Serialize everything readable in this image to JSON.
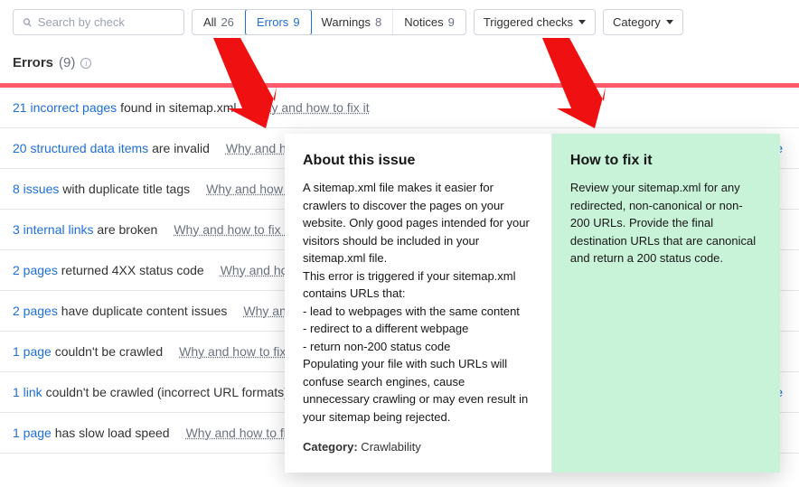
{
  "search": {
    "placeholder": "Search by check"
  },
  "tabs": {
    "all": {
      "label": "All",
      "count": "26"
    },
    "errors": {
      "label": "Errors",
      "count": "9"
    },
    "warnings": {
      "label": "Warnings",
      "count": "8"
    },
    "notices": {
      "label": "Notices",
      "count": "9"
    }
  },
  "dropdowns": {
    "triggered": "Triggered checks",
    "category": "Category"
  },
  "section": {
    "label": "Errors",
    "count": "(9)"
  },
  "why_label": "Why and how to fix it",
  "ue_fragment": "ue",
  "rows": [
    {
      "lead": "21 incorrect pages",
      "rest": " found in sitemap.xml"
    },
    {
      "lead": "20 structured data items",
      "rest": " are invalid"
    },
    {
      "lead": "8 issues",
      "rest": " with duplicate title tags"
    },
    {
      "lead": "3 internal links",
      "rest": " are broken"
    },
    {
      "lead": "2 pages",
      "rest": " returned 4XX status code"
    },
    {
      "lead": "2 pages",
      "rest": " have duplicate content issues"
    },
    {
      "lead": "1 page",
      "rest": " couldn't be crawled"
    },
    {
      "lead": "1 link",
      "rest": " couldn't be crawled (incorrect URL formats)"
    },
    {
      "lead": "1 page",
      "rest": " has slow load speed"
    }
  ],
  "popover": {
    "about_title": "About this issue",
    "about_body": "A sitemap.xml file makes it easier for crawlers to discover the pages on your website. Only good pages intended for your visitors should be included in your sitemap.xml file.\nThis error is triggered if your sitemap.xml contains URLs that:\n- lead to webpages with the same content\n- redirect to a different webpage\n- return non-200 status code\nPopulating your file with such URLs will confuse search engines, cause unnecessary crawling or may even result in your sitemap being rejected.",
    "category_label": "Category:",
    "category_value": " Crawlability",
    "fix_title": "How to fix it",
    "fix_body": "Review your sitemap.xml for any redirected, non-canonical or non-200 URLs. Provide the final destination URLs that are canonical and return a 200 status code."
  }
}
